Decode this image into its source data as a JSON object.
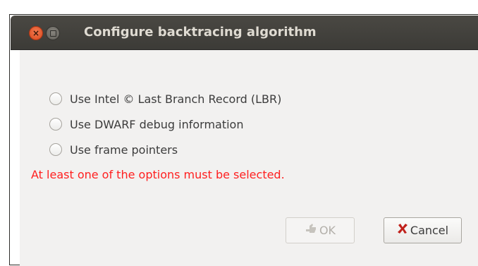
{
  "window": {
    "title": "Configure backtracing algorithm",
    "close_glyph": "×"
  },
  "options": [
    {
      "label": "Use Intel © Last Branch Record (LBR)",
      "selected": false
    },
    {
      "label": "Use DWARF debug information",
      "selected": false
    },
    {
      "label": "Use frame pointers",
      "selected": false
    }
  ],
  "error_message": "At least one of the options must be selected.",
  "buttons": {
    "ok_label": "OK",
    "ok_enabled": false,
    "ok_icon": "ok-hand-icon",
    "cancel_label": "Cancel",
    "cancel_icon": "cancel-x-icon"
  },
  "colors": {
    "titlebar": "#3c3b37",
    "error": "#ff2020",
    "dialog_bg": "#f2f1f0"
  }
}
